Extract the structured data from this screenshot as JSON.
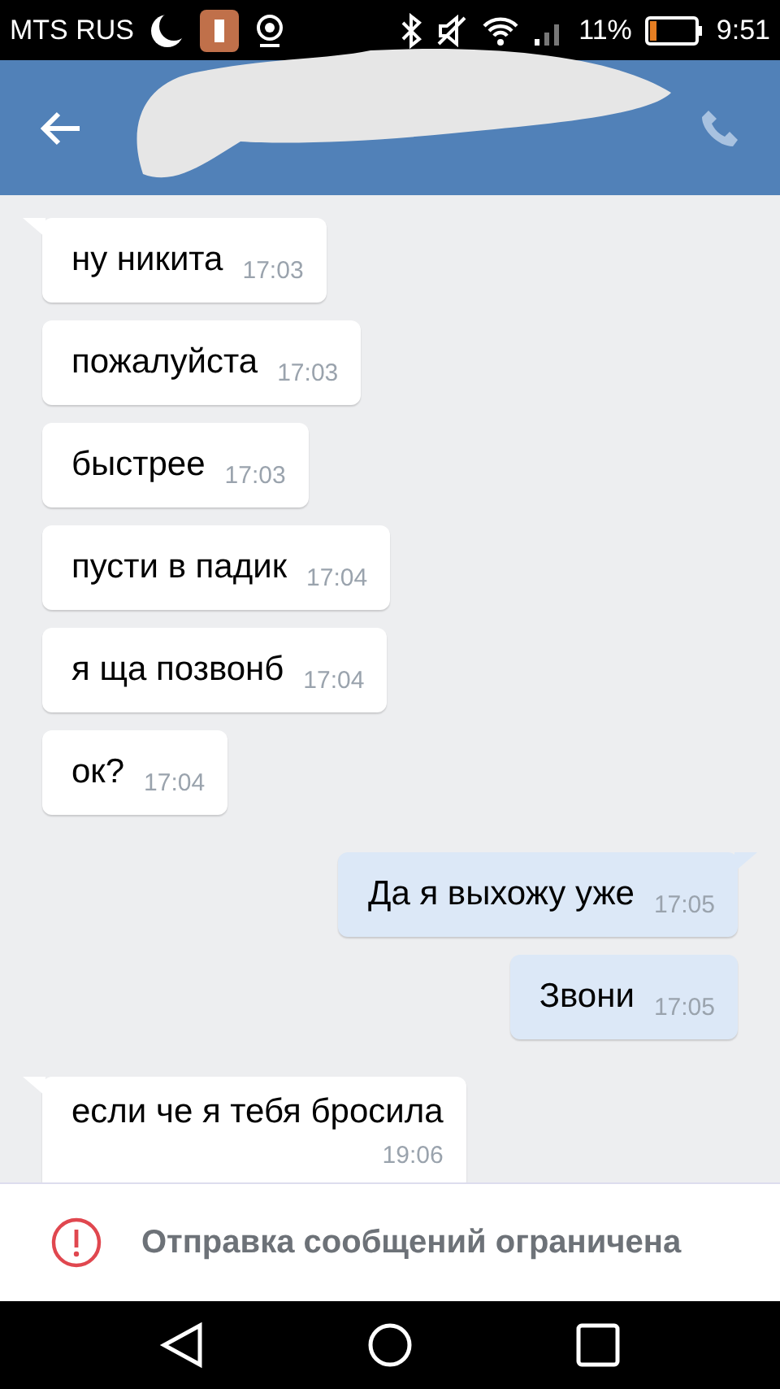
{
  "status_bar": {
    "carrier": "MTS RUS",
    "battery": "11%",
    "time": "9:51"
  },
  "messages": [
    {
      "kind": "in",
      "text": "ну никита",
      "time": "17:03",
      "tail": true,
      "stacked": false
    },
    {
      "kind": "in",
      "text": "пожалуйста",
      "time": "17:03",
      "tail": false,
      "stacked": false
    },
    {
      "kind": "in",
      "text": "быстрее",
      "time": "17:03",
      "tail": false,
      "stacked": false
    },
    {
      "kind": "in",
      "text": "пусти в падик",
      "time": "17:04",
      "tail": false,
      "stacked": false
    },
    {
      "kind": "in",
      "text": "я ща позвонб",
      "time": "17:04",
      "tail": false,
      "stacked": false
    },
    {
      "kind": "in",
      "text": "ок?",
      "time": "17:04",
      "tail": false,
      "stacked": false
    },
    {
      "kind": "out",
      "text": "Да я выхожу уже",
      "time": "17:05",
      "tail": true,
      "stacked": false
    },
    {
      "kind": "out",
      "text": "Звони",
      "time": "17:05",
      "tail": false,
      "stacked": false
    },
    {
      "kind": "in",
      "text": "если че я тебя бросила",
      "time": "19:06",
      "tail": true,
      "stacked": true
    }
  ],
  "notice": "Отправка сообщений ограничена"
}
